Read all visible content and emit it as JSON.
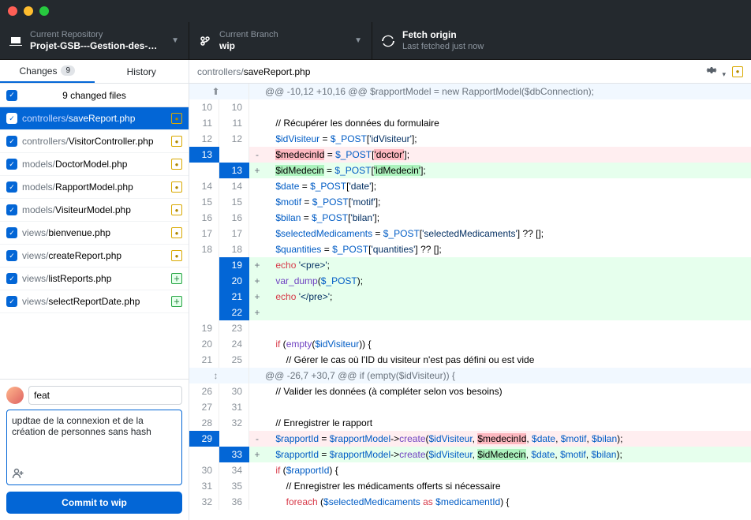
{
  "header": {
    "repo_label": "Current Repository",
    "repo_value": "Projet-GSB---Gestion-des-…",
    "branch_label": "Current Branch",
    "branch_value": "wip",
    "fetch_label": "Fetch origin",
    "fetch_sub": "Last fetched just now"
  },
  "sidebar": {
    "tab_changes": "Changes",
    "tab_changes_count": "9",
    "tab_history": "History",
    "files_header": "9 changed files",
    "files": [
      {
        "dir": "controllers/",
        "name": "saveReport.php",
        "status": "mod",
        "selected": true
      },
      {
        "dir": "controllers/",
        "name": "VisitorController.php",
        "status": "mod"
      },
      {
        "dir": "models/",
        "name": "DoctorModel.php",
        "status": "mod"
      },
      {
        "dir": "models/",
        "name": "RapportModel.php",
        "status": "mod"
      },
      {
        "dir": "models/",
        "name": "VisiteurModel.php",
        "status": "mod"
      },
      {
        "dir": "views/",
        "name": "bienvenue.php",
        "status": "mod"
      },
      {
        "dir": "views/",
        "name": "createReport.php",
        "status": "mod"
      },
      {
        "dir": "views/",
        "name": "listReports.php",
        "status": "add"
      },
      {
        "dir": "views/",
        "name": "selectReportDate.php",
        "status": "add"
      }
    ]
  },
  "commit": {
    "summary": "feat",
    "description": "updtae de la connexion et de la création de personnes sans hash",
    "button": "Commit to wip"
  },
  "diff": {
    "path_dir": "controllers/",
    "path_file": "saveReport.php",
    "lines": [
      {
        "type": "hunk",
        "old": "",
        "new": "",
        "code": "@@ -10,12 +10,16 @@ $rapportModel = new RapportModel($dbConnection);",
        "expand": "top"
      },
      {
        "type": "ctx",
        "old": "10",
        "new": "10",
        "code": ""
      },
      {
        "type": "ctx",
        "old": "11",
        "new": "11",
        "code": "    // Récupérer les données du formulaire"
      },
      {
        "type": "ctx",
        "old": "12",
        "new": "12",
        "code": "    $idVisiteur = $_POST['idVisiteur'];",
        "tokens": [
          [
            "    ",
            ""
          ],
          [
            "$idVisiteur",
            "kw-blue"
          ],
          [
            " = ",
            ""
          ],
          [
            "$_POST",
            "kw-blue"
          ],
          [
            "[",
            ""
          ],
          [
            "'idVisiteur'",
            "kw-str"
          ],
          [
            "];",
            ""
          ]
        ]
      },
      {
        "type": "del",
        "old": "13",
        "new": "",
        "code": "    $medecinId = $_POST['doctor'];",
        "sel_old": true,
        "tokens": [
          [
            "    ",
            ""
          ],
          [
            "$medecinId",
            "hl-del"
          ],
          [
            " = ",
            ""
          ],
          [
            "$_POST",
            "kw-blue"
          ],
          [
            "[",
            ""
          ],
          [
            "'doctor'",
            "hl-del"
          ],
          [
            "];",
            ""
          ]
        ]
      },
      {
        "type": "add",
        "old": "",
        "new": "13",
        "code": "    $idMedecin = $_POST['idMedecin'];",
        "sel_new": true,
        "tokens": [
          [
            "    ",
            ""
          ],
          [
            "$idMedecin",
            "hl-add"
          ],
          [
            " = ",
            ""
          ],
          [
            "$_POST",
            "kw-blue"
          ],
          [
            "[",
            ""
          ],
          [
            "'idMedecin'",
            "hl-add"
          ],
          [
            "];",
            ""
          ]
        ]
      },
      {
        "type": "ctx",
        "old": "14",
        "new": "14",
        "code": "    $date = $_POST['date'];",
        "tokens": [
          [
            "    ",
            ""
          ],
          [
            "$date",
            "kw-blue"
          ],
          [
            " = ",
            ""
          ],
          [
            "$_POST",
            "kw-blue"
          ],
          [
            "[",
            ""
          ],
          [
            "'date'",
            "kw-str"
          ],
          [
            "];",
            ""
          ]
        ]
      },
      {
        "type": "ctx",
        "old": "15",
        "new": "15",
        "code": "    $motif = $_POST['motif'];",
        "tokens": [
          [
            "    ",
            ""
          ],
          [
            "$motif",
            "kw-blue"
          ],
          [
            " = ",
            ""
          ],
          [
            "$_POST",
            "kw-blue"
          ],
          [
            "[",
            ""
          ],
          [
            "'motif'",
            "kw-str"
          ],
          [
            "];",
            ""
          ]
        ]
      },
      {
        "type": "ctx",
        "old": "16",
        "new": "16",
        "code": "    $bilan = $_POST['bilan'];",
        "tokens": [
          [
            "    ",
            ""
          ],
          [
            "$bilan",
            "kw-blue"
          ],
          [
            " = ",
            ""
          ],
          [
            "$_POST",
            "kw-blue"
          ],
          [
            "[",
            ""
          ],
          [
            "'bilan'",
            "kw-str"
          ],
          [
            "];",
            ""
          ]
        ]
      },
      {
        "type": "ctx",
        "old": "17",
        "new": "17",
        "code": "    $selectedMedicaments = $_POST['selectedMedicaments'] ?? [];",
        "tokens": [
          [
            "    ",
            ""
          ],
          [
            "$selectedMedicaments",
            "kw-blue"
          ],
          [
            " = ",
            ""
          ],
          [
            "$_POST",
            "kw-blue"
          ],
          [
            "[",
            ""
          ],
          [
            "'selectedMedicaments'",
            "kw-str"
          ],
          [
            "] ?? [];",
            ""
          ]
        ]
      },
      {
        "type": "ctx",
        "old": "18",
        "new": "18",
        "code": "    $quantities = $_POST['quantities'] ?? [];",
        "tokens": [
          [
            "    ",
            ""
          ],
          [
            "$quantities",
            "kw-blue"
          ],
          [
            " = ",
            ""
          ],
          [
            "$_POST",
            "kw-blue"
          ],
          [
            "[",
            ""
          ],
          [
            "'quantities'",
            "kw-str"
          ],
          [
            "] ?? [];",
            ""
          ]
        ]
      },
      {
        "type": "add",
        "old": "",
        "new": "19",
        "code": "    echo '<pre>';",
        "sel_new": true,
        "tokens": [
          [
            "    ",
            ""
          ],
          [
            "echo",
            "kw-red"
          ],
          [
            " ",
            ""
          ],
          [
            "'<pre>'",
            "kw-str"
          ],
          [
            ";",
            ""
          ]
        ]
      },
      {
        "type": "add",
        "old": "",
        "new": "20",
        "code": "    var_dump($_POST);",
        "sel_new": true,
        "tokens": [
          [
            "    ",
            ""
          ],
          [
            "var_dump",
            "kw-purple"
          ],
          [
            "(",
            ""
          ],
          [
            "$_POST",
            "kw-blue"
          ],
          [
            ");",
            ""
          ]
        ]
      },
      {
        "type": "add",
        "old": "",
        "new": "21",
        "code": "    echo '</pre>';",
        "sel_new": true,
        "tokens": [
          [
            "    ",
            ""
          ],
          [
            "echo",
            "kw-red"
          ],
          [
            " ",
            ""
          ],
          [
            "'</pre>'",
            "kw-str"
          ],
          [
            ";",
            ""
          ]
        ]
      },
      {
        "type": "add",
        "old": "",
        "new": "22",
        "code": "",
        "sel_new": true
      },
      {
        "type": "ctx",
        "old": "19",
        "new": "23",
        "code": ""
      },
      {
        "type": "ctx",
        "old": "20",
        "new": "24",
        "code": "    if (empty($idVisiteur)) {",
        "tokens": [
          [
            "    ",
            ""
          ],
          [
            "if",
            "kw-red"
          ],
          [
            " (",
            ""
          ],
          [
            "empty",
            "kw-purple"
          ],
          [
            "(",
            ""
          ],
          [
            "$idVisiteur",
            "kw-blue"
          ],
          [
            ")) {",
            ""
          ]
        ]
      },
      {
        "type": "ctx",
        "old": "21",
        "new": "25",
        "code": "        // Gérer le cas où l'ID du visiteur n'est pas défini ou est vide"
      },
      {
        "type": "hunk",
        "old": "",
        "new": "",
        "code": "@@ -26,7 +30,7 @@ if (empty($idVisiteur)) {",
        "expand": "mid"
      },
      {
        "type": "ctx",
        "old": "26",
        "new": "30",
        "code": "    // Valider les données (à compléter selon vos besoins)"
      },
      {
        "type": "ctx",
        "old": "27",
        "new": "31",
        "code": ""
      },
      {
        "type": "ctx",
        "old": "28",
        "new": "32",
        "code": "    // Enregistrer le rapport"
      },
      {
        "type": "del",
        "old": "29",
        "new": "",
        "code": "",
        "sel_old": true,
        "tokens": [
          [
            "    ",
            ""
          ],
          [
            "$rapportId",
            "kw-blue"
          ],
          [
            " = ",
            ""
          ],
          [
            "$rapportModel",
            "kw-blue"
          ],
          [
            "->",
            ""
          ],
          [
            "create",
            "kw-purple"
          ],
          [
            "(",
            ""
          ],
          [
            "$idVisiteur",
            "kw-blue"
          ],
          [
            ", ",
            ""
          ],
          [
            "$medecinId",
            "hl-del"
          ],
          [
            ", ",
            ""
          ],
          [
            "$date",
            "kw-blue"
          ],
          [
            ", ",
            ""
          ],
          [
            "$motif",
            "kw-blue"
          ],
          [
            ", ",
            ""
          ],
          [
            "$bilan",
            "kw-blue"
          ],
          [
            ");",
            ""
          ]
        ]
      },
      {
        "type": "add",
        "old": "",
        "new": "33",
        "code": "",
        "sel_new": true,
        "tokens": [
          [
            "    ",
            ""
          ],
          [
            "$rapportId",
            "kw-blue"
          ],
          [
            " = ",
            ""
          ],
          [
            "$rapportModel",
            "kw-blue"
          ],
          [
            "->",
            ""
          ],
          [
            "create",
            "kw-purple"
          ],
          [
            "(",
            ""
          ],
          [
            "$idVisiteur",
            "kw-blue"
          ],
          [
            ", ",
            ""
          ],
          [
            "$idMedecin",
            "hl-add"
          ],
          [
            ", ",
            ""
          ],
          [
            "$date",
            "kw-blue"
          ],
          [
            ", ",
            ""
          ],
          [
            "$motif",
            "kw-blue"
          ],
          [
            ", ",
            ""
          ],
          [
            "$bilan",
            "kw-blue"
          ],
          [
            ");",
            ""
          ]
        ]
      },
      {
        "type": "ctx",
        "old": "30",
        "new": "34",
        "code": "    if ($rapportId) {",
        "tokens": [
          [
            "    ",
            ""
          ],
          [
            "if",
            "kw-red"
          ],
          [
            " (",
            ""
          ],
          [
            "$rapportId",
            "kw-blue"
          ],
          [
            ") {",
            ""
          ]
        ]
      },
      {
        "type": "ctx",
        "old": "31",
        "new": "35",
        "code": "        // Enregistrer les médicaments offerts si nécessaire"
      },
      {
        "type": "ctx",
        "old": "32",
        "new": "36",
        "code": "        foreach ($selectedMedicaments as $medicamentId) {",
        "tokens": [
          [
            "        ",
            ""
          ],
          [
            "foreach",
            "kw-red"
          ],
          [
            " (",
            ""
          ],
          [
            "$selectedMedicaments",
            "kw-blue"
          ],
          [
            " ",
            ""
          ],
          [
            "as",
            "kw-red"
          ],
          [
            " ",
            ""
          ],
          [
            "$medicamentId",
            "kw-blue"
          ],
          [
            ") {",
            ""
          ]
        ]
      }
    ]
  }
}
